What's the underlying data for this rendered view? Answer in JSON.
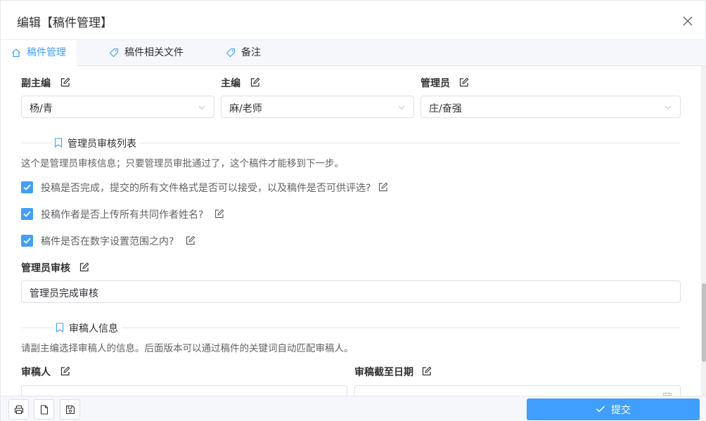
{
  "dialog": {
    "title": "编辑【稿件管理】"
  },
  "tabs": [
    {
      "label": "稿件管理",
      "icon": "home-icon",
      "active": true
    },
    {
      "label": "稿件相关文件",
      "icon": "tag-icon",
      "active": false
    },
    {
      "label": "备注",
      "icon": "tag-icon",
      "active": false
    }
  ],
  "fields": {
    "deputy_editor": {
      "label": "副主编",
      "value": "杨/青"
    },
    "chief_editor": {
      "label": "主编",
      "value": "麻/老师"
    },
    "admin": {
      "label": "管理员",
      "value": "庄/奋强"
    }
  },
  "admin_review_section": {
    "title": "管理员审核列表",
    "description": "这个是管理员审核信息；只要管理员审批通过了，这个稿件才能移到下一步。",
    "checks": [
      {
        "label": "投稿是否完成，提交的所有文件格式是否可以接受，以及稿件是否可供评选?",
        "checked": true
      },
      {
        "label": "投稿作者是否上传所有共同作者姓名?",
        "checked": true
      },
      {
        "label": "稿件是否在数字设置范围之内?",
        "checked": true
      }
    ],
    "review_label": "管理员审核",
    "review_value": "管理员完成审核"
  },
  "reviewer_section": {
    "title": "审稿人信息",
    "description": "请副主编选择审稿人的信息。后面版本可以通过稿件的关键词自动匹配审稿人。",
    "reviewer_label": "审稿人",
    "deadline_label": "审稿截至日期"
  },
  "footer": {
    "submit_label": "提交"
  },
  "colors": {
    "primary": "#409eff",
    "border": "#dcdfe6",
    "text": "#303133",
    "secondary_text": "#606266"
  }
}
